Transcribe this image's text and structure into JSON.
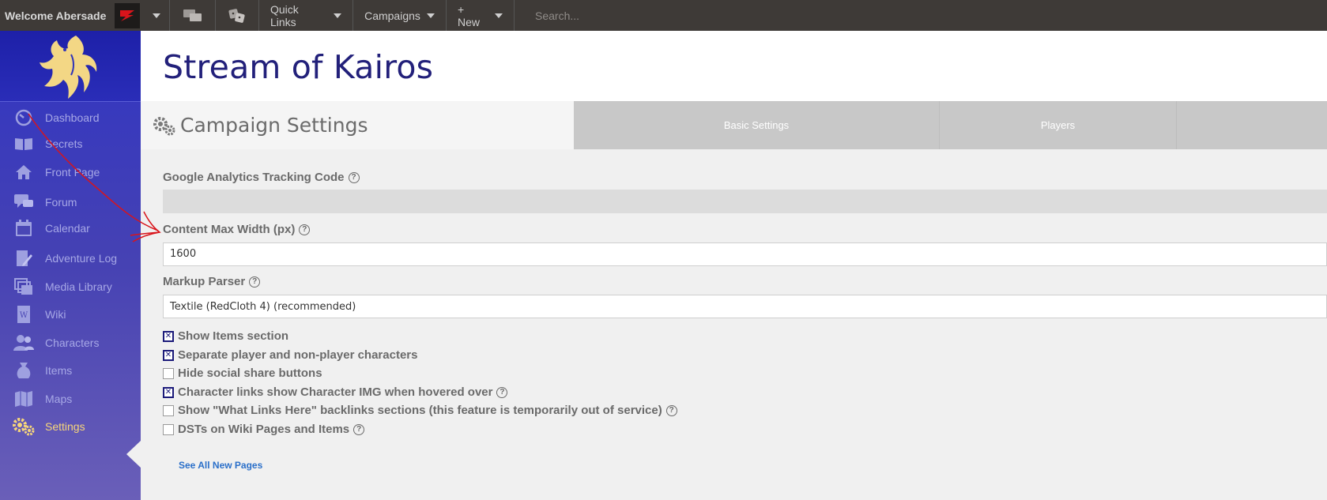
{
  "topbar": {
    "welcome": "Welcome Abersade",
    "quick_links": "Quick Links",
    "campaigns": "Campaigns",
    "new": "+ New",
    "search_placeholder": "Search..."
  },
  "sidebar": {
    "items": [
      {
        "label": "Dashboard",
        "icon": "dashboard-icon"
      },
      {
        "label": "Secrets",
        "icon": "book-icon"
      },
      {
        "label": "Front Page",
        "icon": "home-icon"
      },
      {
        "label": "Forum",
        "icon": "chat-icon"
      },
      {
        "label": "Calendar",
        "icon": "calendar-icon"
      },
      {
        "label": "Adventure Log",
        "icon": "pencil-icon"
      },
      {
        "label": "Media Library",
        "icon": "images-icon"
      },
      {
        "label": "Wiki",
        "icon": "wiki-icon"
      },
      {
        "label": "Characters",
        "icon": "people-icon"
      },
      {
        "label": "Items",
        "icon": "pouch-icon"
      },
      {
        "label": "Maps",
        "icon": "map-icon"
      },
      {
        "label": "Settings",
        "icon": "gears-icon",
        "active": true
      }
    ]
  },
  "page": {
    "title": "Stream of Kairos",
    "section_title": "Campaign Settings",
    "tabs": [
      "Basic Settings",
      "Players"
    ]
  },
  "form": {
    "ga_label": "Google Analytics Tracking Code",
    "ga_value": "",
    "width_label": "Content Max Width (px)",
    "width_value": "1600",
    "parser_label": "Markup Parser",
    "parser_value": "Textile (RedCloth 4) (recommended)",
    "checkboxes": [
      {
        "label": "Show Items section",
        "checked": true
      },
      {
        "label": "Separate player and non-player characters",
        "checked": true
      },
      {
        "label": "Hide social share buttons",
        "checked": false
      },
      {
        "label": "Character links show Character IMG when hovered over",
        "checked": true,
        "help": true
      },
      {
        "label": "Show \"What Links Here\" backlinks sections (this feature is temporarily out of service)",
        "checked": false,
        "help": true
      },
      {
        "label": "DSTs on Wiki Pages and Items",
        "checked": false,
        "help": true
      }
    ],
    "help_glyph": "?"
  },
  "footer_link": "See All New Pages",
  "colors": {
    "topbar": "#3e3a37",
    "sidebar": "#3135c2",
    "title": "#22207a",
    "active": "#f7d67a",
    "annotation": "#d9141b"
  }
}
